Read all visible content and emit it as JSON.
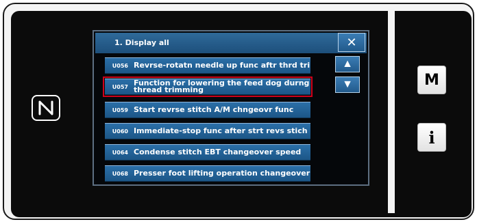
{
  "screen": {
    "title": "1.   Display all",
    "close_label": "✕",
    "scroll_up_label": "▲",
    "scroll_down_label": "▼"
  },
  "items": [
    {
      "code": "U056",
      "label": "Revrse-rotatn needle up func aftr thrd trim"
    },
    {
      "code": "U057",
      "label": "Function for lowering the feed dog durng thread trimming",
      "selected": true
    },
    {
      "code": "U059",
      "label": "Start revrse stitch A/M chngeovr func"
    },
    {
      "code": "U060",
      "label": "Immediate-stop func after strt revs stich"
    },
    {
      "code": "U064",
      "label": "Condense stitch EBT changeover speed"
    },
    {
      "code": "U068",
      "label": "Presser foot lifting operation changeover"
    }
  ],
  "side": {
    "mode_label": "M",
    "info_label": "i"
  },
  "icons": {
    "nfc": "nfc-icon",
    "close": "close-icon",
    "up": "arrow-up-icon",
    "down": "arrow-down-icon"
  },
  "colors": {
    "row": "#2b6fa8",
    "highlight": "#d0001a",
    "bezel": "#0b0b0b"
  }
}
